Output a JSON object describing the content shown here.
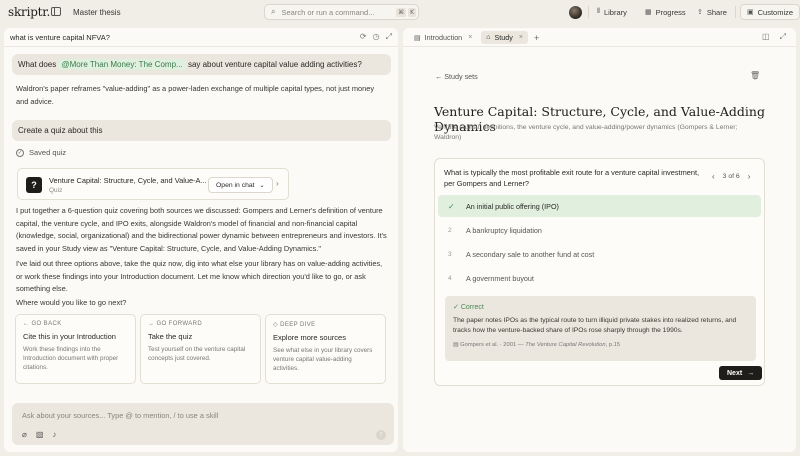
{
  "app": {
    "logo": "skriptr.",
    "doc_title": "Master thesis"
  },
  "command": {
    "placeholder": "Search or run a command...",
    "kbd1": "⌘",
    "kbd2": "K"
  },
  "toolbar": {
    "library": "Library",
    "progress": "Progress",
    "share": "Share",
    "customize": "Customize"
  },
  "chat": {
    "title": "what is venture capital NFVA?",
    "msg1_pre": "What does",
    "msg1_mention": "@More Than Money: The Comp...",
    "msg1_post": "say about venture capital value adding activities?",
    "reply1": "Waldron's paper reframes \"value-adding\" as a power-laden exchange of multiple capital types, not just money and advice.",
    "msg2": "Create a quiz about this",
    "saved_label": "Saved quiz",
    "quiz_card": {
      "title": "Venture Capital: Structure, Cycle, and Value-A...",
      "subtitle": "Quiz",
      "open_label": "Open in chat"
    },
    "reply2": "I put together a 6-question quiz covering both sources we discussed: Gompers and Lerner's definition of venture capital, the venture cycle, and IPO exits, alongside Waldron's model of financial and non-financial capital (knowledge, social, organizational) and the bidirectional power dynamic between entrepreneurs and investors. It's saved in your Study view as \"Venture Capital: Structure, Cycle, and Value-Adding Dynamics.\"",
    "reply3": "I've laid out three options above, take the quiz now, dig into what else your library has on value-adding activities, or work these findings into your Introduction document. Let me know which direction you'd like to go, or ask something else.",
    "where_next": "Where would you like to go next?",
    "options": [
      {
        "tag": "← GO BACK",
        "title": "Cite this in your Introduction",
        "desc": "Work these findings into the Introduction document with proper citations."
      },
      {
        "tag": "→ GO FORWARD",
        "title": "Take the quiz",
        "desc": "Test yourself on the venture capital concepts just covered."
      },
      {
        "tag": "◇ DEEP DIVE",
        "title": "Explore more sources",
        "desc": "See what else in your library covers venture capital value-adding activities."
      }
    ],
    "composer_placeholder": "Ask about your sources... Type @ to mention, / to use a skill"
  },
  "study": {
    "tabs": [
      {
        "label": "Introduction"
      },
      {
        "label": "Study"
      }
    ],
    "back_label": "Study sets",
    "title": "Venture Capital: Structure, Cycle, and Value-Adding Dynamics",
    "subtitle": "Venture capital: definitions, the venture cycle, and value-adding/power dynamics (Gompers & Lerner; Waldron)",
    "question": "What is typically the most profitable exit route for a venture capital investment, per Gompers and Lerner?",
    "counter": "3 of 6",
    "answers": [
      {
        "num": "✓",
        "label": "An initial public offering (IPO)"
      },
      {
        "num": "2",
        "label": "A bankruptcy liquidation"
      },
      {
        "num": "3",
        "label": "A secondary sale to another fund at cost"
      },
      {
        "num": "4",
        "label": "A government buyout"
      }
    ],
    "feedback": {
      "label": "Correct",
      "text": "The paper notes IPOs as the typical route to turn illiquid private stakes into realized returns, and tracks how the venture-backed share of IPOs rose sharply through the 1990s.",
      "cite_pre": "Gompers et al. · 2001 —",
      "cite_work": "The Venture Capital Revolution",
      "cite_post": ", p.15"
    },
    "next_label": "Next"
  }
}
